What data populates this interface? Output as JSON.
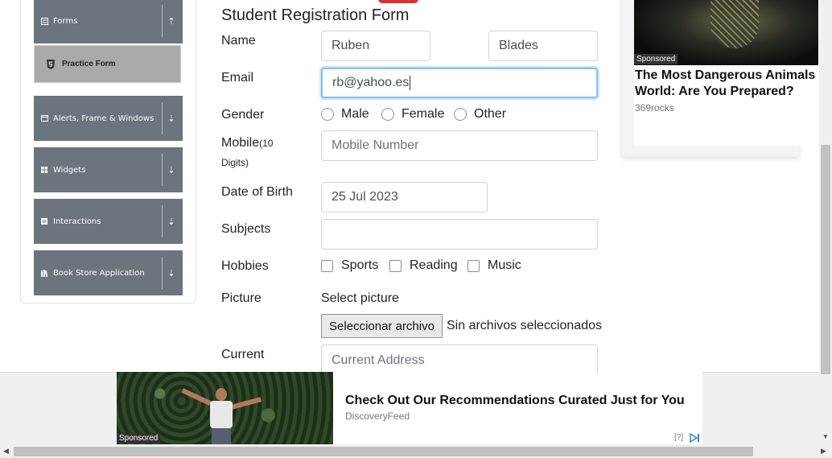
{
  "sidebar": {
    "groups": [
      {
        "label": "Forms",
        "icon": "form-icon",
        "arrow": "chevron-up-icon"
      },
      {
        "label": "Alerts, Frame & Windows",
        "icon": "window-icon",
        "arrow": "chevron-down-icon"
      },
      {
        "label": "Widgets",
        "icon": "grid-icon",
        "arrow": "chevron-down-icon"
      },
      {
        "label": "Interactions",
        "icon": "interaction-icon",
        "arrow": "chevron-down-icon"
      },
      {
        "label": "Book Store Application",
        "icon": "books-icon",
        "arrow": "chevron-down-icon"
      }
    ],
    "active_item": {
      "label": "Practice Form",
      "icon": "html5-icon"
    }
  },
  "form": {
    "title": "Student Registration Form",
    "name": {
      "label": "Name",
      "first": "Ruben",
      "last": "Blades"
    },
    "email": {
      "label": "Email",
      "value": "rb@yahoo.es"
    },
    "gender": {
      "label": "Gender",
      "options": [
        "Male",
        "Female",
        "Other"
      ]
    },
    "mobile": {
      "label": "Mobile",
      "label_suffix": "(10",
      "label_line2": "Digits)",
      "placeholder": "Mobile Number"
    },
    "dob": {
      "label": "Date of Birth",
      "value": "25 Jul 2023"
    },
    "subjects": {
      "label": "Subjects",
      "value": ""
    },
    "hobbies": {
      "label": "Hobbies",
      "options": [
        "Sports",
        "Reading",
        "Music"
      ]
    },
    "picture": {
      "label": "Picture",
      "select_label": "Select picture",
      "button": "Seleccionar archivo",
      "status": "Sin archivos seleccionados"
    },
    "address": {
      "label": "Current",
      "placeholder": "Current Address"
    }
  },
  "ads": {
    "right": {
      "sponsored": "Sponsored",
      "headline": "The Most Dangerous Animals World: Are You Prepared?",
      "source": "369rocks"
    },
    "bottom": {
      "sponsored": "Sponsored",
      "headline": "Check Out Our Recommendations Curated Just for You",
      "source": "DiscoveryFeed",
      "help": "[?]"
    }
  },
  "colors": {
    "sidebar_group": "#6c757d",
    "active_item": "#aaaaaa",
    "focus_border": "#80bdff"
  }
}
